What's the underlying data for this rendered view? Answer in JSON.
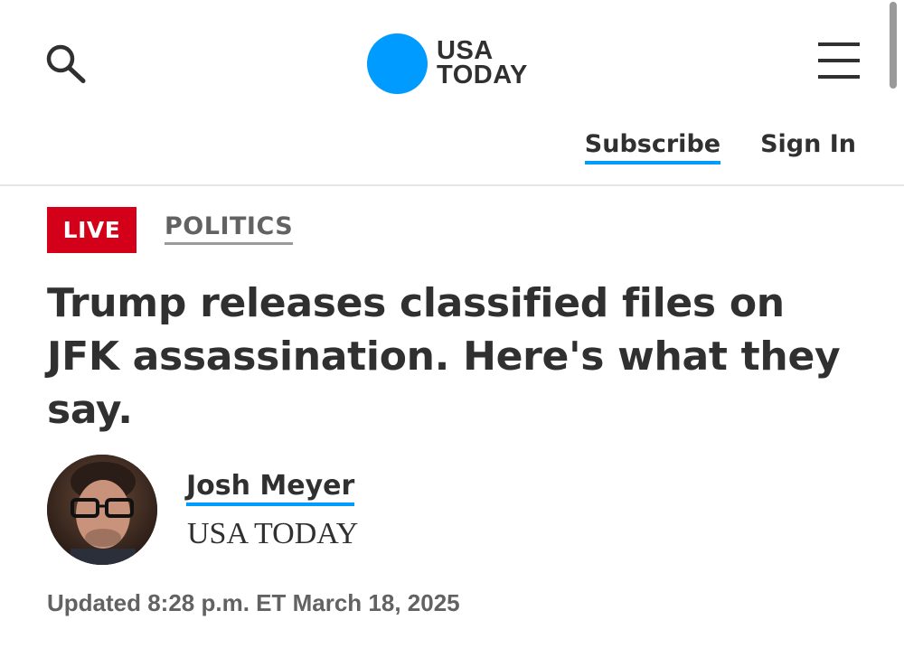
{
  "header": {
    "search_icon": "search-icon",
    "menu_icon": "hamburger-menu-icon",
    "logo": {
      "line1": "USA",
      "line2": "TODAY",
      "dot_color": "#009bff"
    },
    "subscribe_label": "Subscribe",
    "sign_in_label": "Sign In"
  },
  "article": {
    "live_label": "LIVE",
    "section_label": "POLITICS",
    "headline": "Trump releases classified files on JFK assassination. Here's what they say.",
    "author": {
      "name": "Josh Meyer",
      "organization": "USA TODAY"
    },
    "updated": "Updated 8:28 p.m. ET March 18, 2025"
  },
  "colors": {
    "accent": "#009bff",
    "live": "#d4001a",
    "text": "#303030",
    "muted": "#626262"
  }
}
